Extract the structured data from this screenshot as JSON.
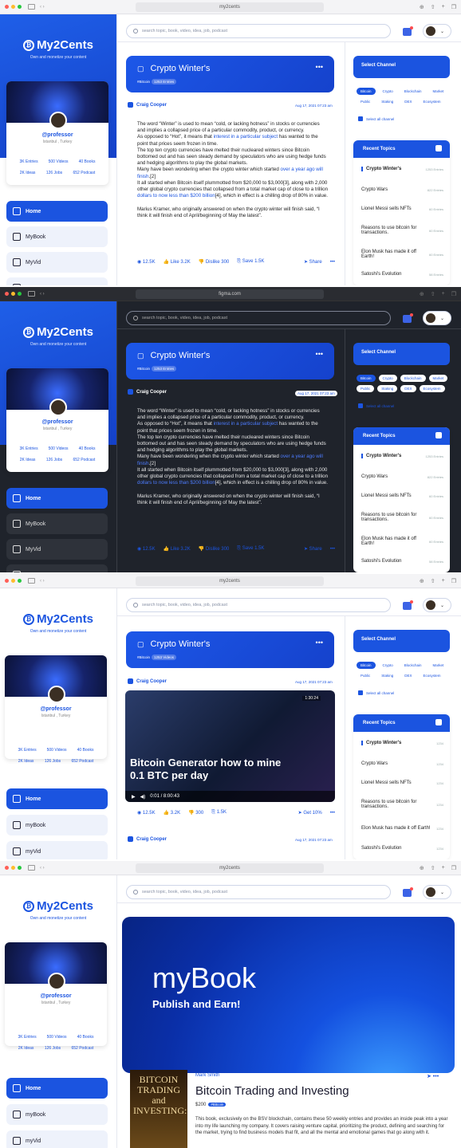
{
  "app": {
    "name": "My2Cents",
    "tagline": "Own and monetize your content"
  },
  "urls": {
    "f1": "my2cents",
    "f2": "figma.com",
    "f3": "my2cents",
    "f4": "my2cents"
  },
  "profile": {
    "name": "@professor",
    "location": "Istanbul , Turkey",
    "s1": [
      "3K Entries",
      "500 Videos",
      "40 Books"
    ],
    "s2": [
      "2K Ideas",
      "126 Jobs",
      "652 Podcast"
    ],
    "s1b": [
      "3K Entries",
      "500 Videos",
      "40 Books"
    ],
    "s2b": [
      "2K Ideas",
      "126 Jobs",
      "652 Podcast"
    ]
  },
  "menu": {
    "home": "Home",
    "book": "MyBook",
    "vid": "MyVid",
    "book_lc": "myBook",
    "vid_lc": "myVid"
  },
  "search": {
    "placeholder": "search topic, book, video, idea, job, podcast"
  },
  "topic": {
    "title": "Crypto Winter's",
    "tag": "#Bitcoin",
    "count": "1253 Entries",
    "count_v": "1253 Videos"
  },
  "post": {
    "author": "Craig Cooper",
    "date": "Aug 17, 2021 07:23 am",
    "p1": "The word “Winter” is used to mean “cold, or lacking hotness” in stocks or currencies and implies a collapsed price of a particular commodity, product, or currency.",
    "p2a": "As opposed to “Hot”, it means that ",
    "p2link": "interest in a particular subject",
    "p2b": " has wanted to the point that prices seem frozen in time.",
    "p3": "The top ten crypto currencies have melted their nucleared winters since Bitcoin bottomed out and has seen steady demand by speculators who are using hedge funds and hedging algorithms to play the global markets.",
    "p4a": "Many have been wondering when the crypto winter which started ",
    "p4link": "over a year ago will finish",
    "p4b": ".[2]",
    "p5a": "It all started when Bitcoin itself plummotted from $20,000 to $3,000[3], along with 2,000 other global crypto currencies that collapsed from a total market cap of close to a trillion ",
    "p5link": "dollars to now less than $200 billion",
    "p5b": "[4], which in effect is a chilling drop of 80% in value.",
    "p6": "Marius Kramer, who originally answered on when the crypto winter will finish said, “I think it will finish end of April/beginning of May the latest”."
  },
  "actions": {
    "views": "12.5K",
    "like": "Like 3.2K",
    "dislike": "Dislike 300",
    "save": "Save 1.5K",
    "share": "Share",
    "more": "•••"
  },
  "actions3": {
    "views": "12.5K",
    "like": "3.2K",
    "dislike": "300",
    "save": "1.5K",
    "get": "Get 10%"
  },
  "channel": {
    "title": "Select Channel",
    "chips": [
      "Bitcoin",
      "Crypto",
      "Blockchain",
      "Market",
      "Public",
      "Staking",
      "DEX",
      "Ecosystem"
    ],
    "all": "Select all channel"
  },
  "recent": {
    "title": "Recent Topics",
    "items": [
      {
        "t": "Crypto Winter's",
        "c": "1253 Entries"
      },
      {
        "t": "Crypto Wars",
        "c": "822 Entries"
      },
      {
        "t": "Lionel Messi sells NFTs",
        "c": "60 Entries"
      },
      {
        "t": "Reasons to use bitcoin for transactions.",
        "c": "60 Entries"
      },
      {
        "t": "Elon Musk has made it off Earth!",
        "c": "60 Entries"
      },
      {
        "t": "Satoshi's Evolution",
        "c": "58 Entries"
      }
    ],
    "counts3": [
      "1234",
      "1234",
      "1234",
      "1234",
      "1234",
      "1234"
    ]
  },
  "video": {
    "title": "Bitcoin Generator how to mine 0.1 BTC per day",
    "duration": "1:30:24",
    "time": "0:01 / 8:00:43"
  },
  "hero": {
    "title": "myBook",
    "subtitle": "Publish and Earn!"
  },
  "book": {
    "author": "Mark Smith",
    "title": "Bitcoin Trading and Investing",
    "price": "$200",
    "tag": "#Bitcoin",
    "cover": "BITCOIN TRADING and INVESTING:",
    "desc": "This book, exclusively on the BSV blockchain, contains these 50 weekly entries and provides an inside peak into a year into my life launching my company. It covers raising venture capital, prioritizing the product, defining and searching for the market, trying to find business models that fit, and all the mental and emotional games that go along with it."
  }
}
